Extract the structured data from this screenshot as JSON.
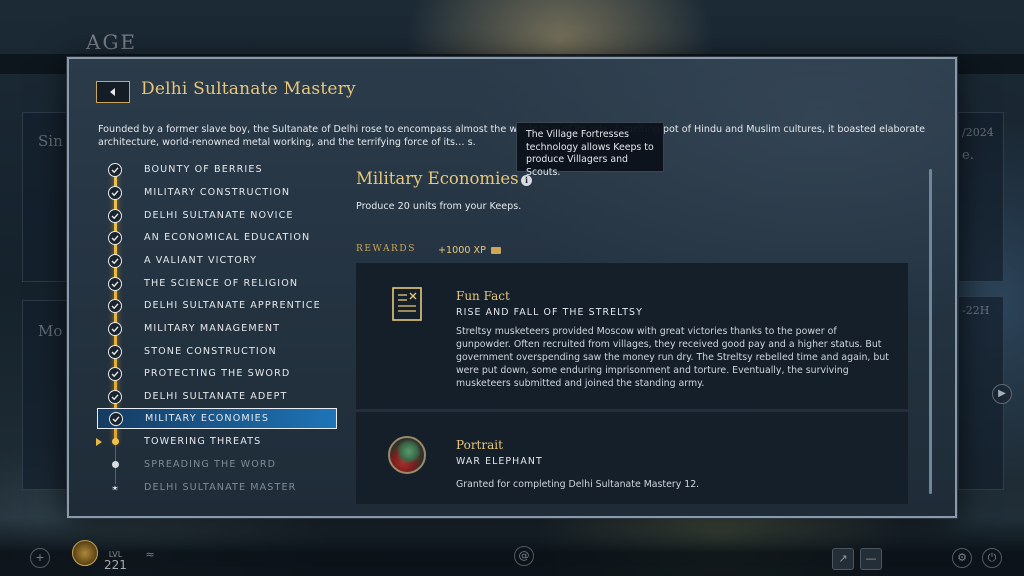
{
  "background": {
    "title": "AGE",
    "card_texts": [
      "Sin",
      "Mo",
      "/2024",
      "e.",
      "-22H"
    ],
    "hud": {
      "level_label": "LVL",
      "level_value": "221"
    }
  },
  "modal": {
    "title": "Delhi Sultanate Mastery",
    "description": "Founded by a former slave boy, the Sultanate of Delhi rose to encompass almost the whole In… of its rule. A melting pot of Hindu and Muslim cultures, it boasted elaborate architecture, world-renowned metal working, and the terrifying force of its… s."
  },
  "progression": [
    {
      "label": "BOUNTY OF BERRIES",
      "state": "completed"
    },
    {
      "label": "MILITARY CONSTRUCTION",
      "state": "completed"
    },
    {
      "label": "DELHI SULTANATE NOVICE",
      "state": "completed"
    },
    {
      "label": "AN ECONOMICAL EDUCATION",
      "state": "completed"
    },
    {
      "label": "A VALIANT VICTORY",
      "state": "completed"
    },
    {
      "label": "THE SCIENCE OF RELIGION",
      "state": "completed"
    },
    {
      "label": "DELHI SULTANATE APPRENTICE",
      "state": "completed"
    },
    {
      "label": "MILITARY MANAGEMENT",
      "state": "completed"
    },
    {
      "label": "STONE CONSTRUCTION",
      "state": "completed"
    },
    {
      "label": "PROTECTING THE SWORD",
      "state": "completed"
    },
    {
      "label": "DELHI SULTANATE ADEPT",
      "state": "completed"
    },
    {
      "label": "MILITARY ECONOMIES",
      "state": "selected"
    },
    {
      "label": "TOWERING THREATS",
      "state": "current"
    },
    {
      "label": "SPREADING THE WORD",
      "state": "locked"
    },
    {
      "label": "DELHI SULTANATE MASTER",
      "state": "locked-final"
    }
  ],
  "detail": {
    "title": "Military Economies",
    "description": "Produce 20 units from your Keeps.",
    "rewards_label": "REWARDS",
    "xp": "+1000 XP",
    "cards": [
      {
        "title": "Fun Fact",
        "subtitle": "RISE AND FALL OF THE STRELTSY",
        "icon": "document-icon",
        "body": "Streltsy musketeers provided Moscow with great victories thanks to the power of gunpowder. Often recruited from villages, they received good pay and a higher status. But government overspending saw the money run dry. The Streltsy rebelled time and again, but were put down, some enduring imprisonment and torture. Eventually, the surviving musketeers submitted and joined the standing army."
      },
      {
        "title": "Portrait",
        "subtitle": "WAR ELEPHANT",
        "icon": "war-elephant-portrait",
        "body": "Granted for completing Delhi Sultanate Mastery 12."
      }
    ]
  },
  "tooltip": {
    "text": "The Village Fortresses technology allows Keeps to produce Villagers and Scouts."
  },
  "colors": {
    "gold": "#e7c87a",
    "selected_blue": "#1e78be",
    "panel": "#253442"
  }
}
